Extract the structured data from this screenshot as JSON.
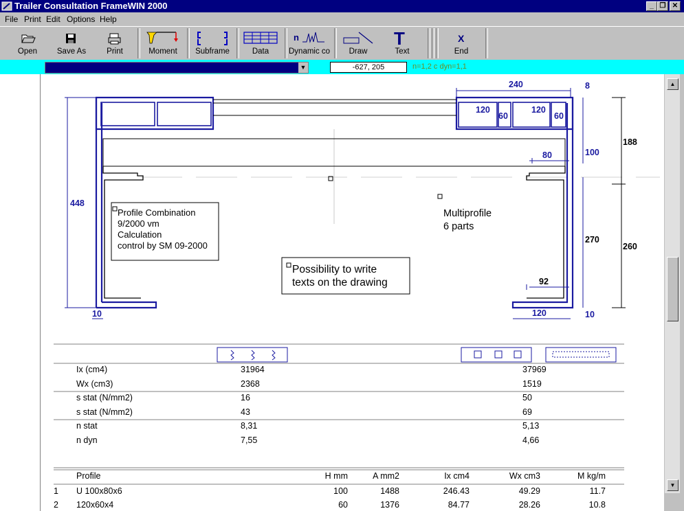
{
  "window": {
    "title": "Trailer Consultation  FrameWIN 2000",
    "minimize": "_",
    "restore": "❐",
    "close": "✕"
  },
  "menu": [
    "File",
    "Print",
    "Edit",
    "Options",
    "Help"
  ],
  "toolbar": {
    "open": "Open",
    "save_as": "Save As",
    "print": "Print",
    "moment": "Moment",
    "subframe": "Subframe",
    "data": "Data",
    "dynamic": "Dynamic co",
    "draw": "Draw",
    "text": "Text",
    "end": "End",
    "dynamic_icon_letter": "n",
    "text_icon_letter": "T",
    "end_icon_letter": "X"
  },
  "status": {
    "coords": "-627, 205",
    "info": "n=1,2   c dyn=1,1"
  },
  "colors": {
    "title_bg": "#000080",
    "status_bg": "#00ffff",
    "dimension": "#1a1aa0",
    "profile": "#1a1aa0"
  },
  "drawing": {
    "dimensions": {
      "top_width": "240",
      "top_right_8": "8",
      "cell1": "120",
      "cell2": "60",
      "cell3": "120",
      "cell4": "60",
      "h100": "100",
      "h188": "188",
      "w80": "80",
      "left_448": "448",
      "h270": "270",
      "h260": "260",
      "w92": "92",
      "bottom_10_left": "10",
      "bottom_120": "120",
      "bottom_10_right": "10"
    },
    "note1": [
      "Profile Combination",
      "9/2000  vm",
      "Calculation",
      "control by  SM 09-2000"
    ],
    "note2": [
      "Multiprofile",
      "6 parts"
    ],
    "note3": [
      "Possibility to write",
      "texts on the drawing"
    ]
  },
  "results": {
    "rows": [
      {
        "label": "Ix (cm4)",
        "v1": "31964",
        "v2": "37969"
      },
      {
        "label": "Wx (cm3)",
        "v1": "2368",
        "v2": "1519"
      },
      {
        "label": "s stat (N/mm2)",
        "v1": "16",
        "v2": "50"
      },
      {
        "label": "s stat (N/mm2)",
        "v1": "43",
        "v2": "69"
      },
      {
        "label": "n stat",
        "v1": "8,31",
        "v2": "5,13"
      },
      {
        "label": "n dyn",
        "v1": "7,55",
        "v2": "4,66"
      }
    ]
  },
  "profiles": {
    "headers": [
      "Profile",
      "H mm",
      "A mm2",
      "Ix cm4",
      "Wx cm3",
      "M kg/m"
    ],
    "rows": [
      {
        "num": "1",
        "name": "U 100x80x6",
        "h": "100",
        "a": "1488",
        "ix": "246.43",
        "wx": "49.29",
        "m": "11.7"
      },
      {
        "num": "2",
        "name": "120x60x4",
        "h": "60",
        "a": "1376",
        "ix": "84.77",
        "wx": "28.26",
        "m": "10.8"
      }
    ]
  }
}
